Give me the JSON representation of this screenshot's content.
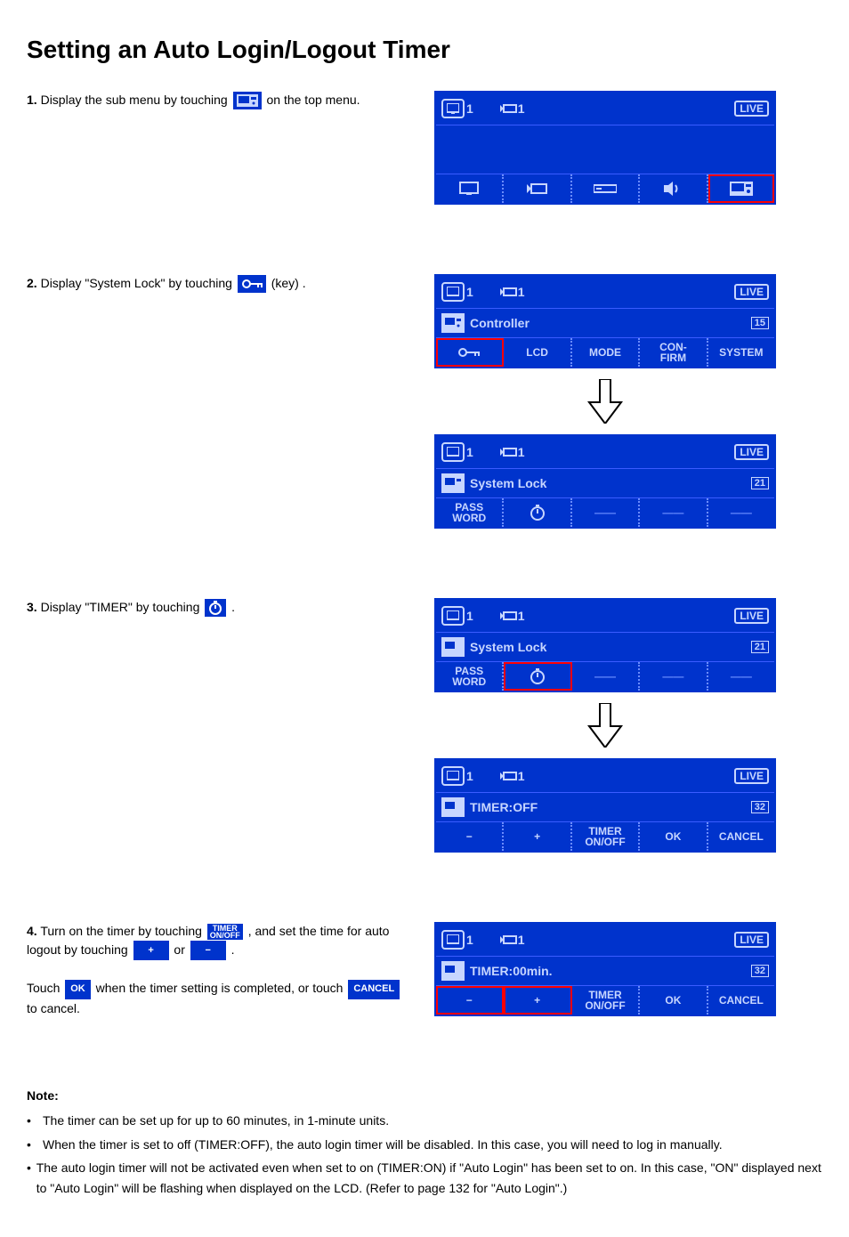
{
  "title": "Setting an Auto Login/Logout Timer",
  "steps": {
    "s1": {
      "pre": "Display the sub menu by touching ",
      "post": " on the top menu."
    },
    "s2": {
      "pre": "Display \"System Lock\" by touching ",
      "post": " .",
      "hint": "(key)"
    },
    "s3": {
      "pre": "Display \"TIMER\" by touching ",
      "post": " ."
    },
    "s4": {
      "line1_a": "Turn on the timer by touching ",
      "line1_b": " , and set the time for auto logout by touching ",
      "line1_c": " or ",
      "line1_d": " .",
      "line2_a": "Touch ",
      "line2_b": " when the timer setting is completed, or touch ",
      "line2_c": " to cancel."
    }
  },
  "btn": {
    "timer_onoff": "TIMER ON/OFF",
    "plus": "+",
    "minus": "−",
    "ok": "OK",
    "cancel": "CANCEL"
  },
  "lcd": {
    "monitor_num": "1",
    "camera_num": "1",
    "live": "LIVE",
    "controller_title": "Controller",
    "controller_page": "15",
    "tabs": {
      "lcd": "LCD",
      "mode": "MODE",
      "confirm": "CON-\nFIRM",
      "system": "SYSTEM"
    },
    "syslock_title": "System Lock",
    "syslock_page": "21",
    "password": "PASS\nWORD",
    "timer_off": "TIMER:OFF",
    "timer_00": "TIMER:00min.",
    "timer_page": "32",
    "bot": {
      "minus": "−",
      "plus": "+",
      "timer_onoff": "TIMER\nON/OFF",
      "ok": "OK",
      "cancel": "CANCEL"
    }
  },
  "notes": {
    "heading": "Note:",
    "n1": "The timer can be set up for up to 60 minutes, in 1-minute units.",
    "n2": "When the timer is set to off (TIMER:OFF), the auto login timer will be disabled. In this case, you will need to log in manually.",
    "n3_a": "The auto login timer will not be activated even when set to on (TIMER:ON) if \"Auto Login\" has been set to on. In this case, \"ON\" displayed next to \"Auto Login\" will be flashing when displayed on the LCD. (Refer to page ",
    "n3_page": "132",
    "n3_b": " for \"Auto Login\".)"
  }
}
